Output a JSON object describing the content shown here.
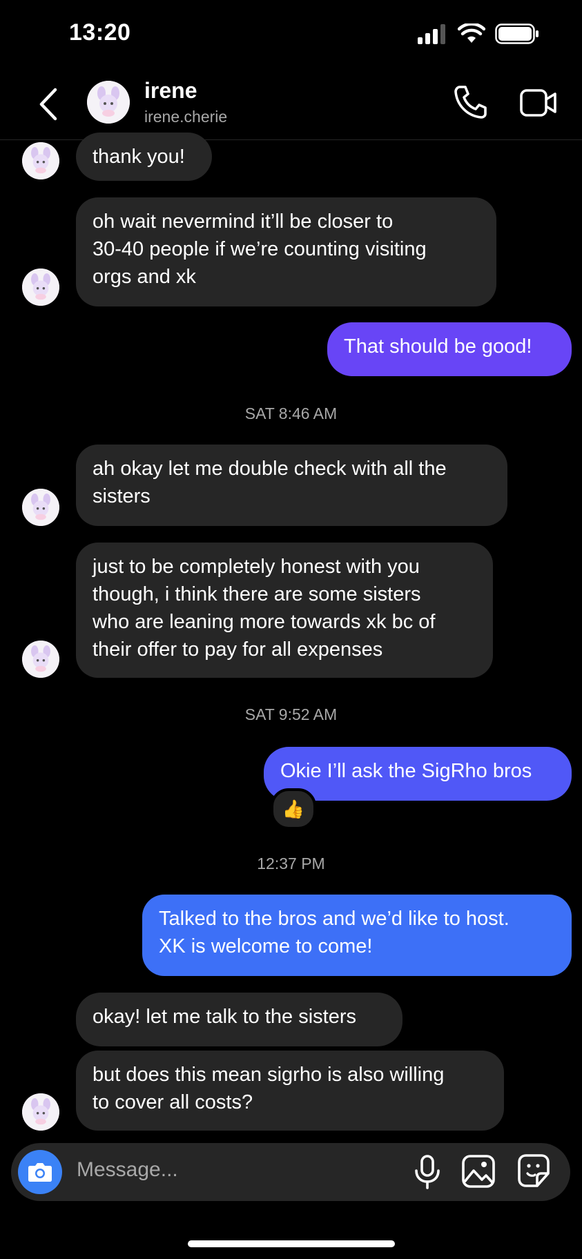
{
  "status_bar": {
    "time": "13:20"
  },
  "header": {
    "name": "irene",
    "username": "irene.cherie"
  },
  "messages": [
    {
      "text": "thank you!"
    },
    {
      "text": "oh wait nevermind it’ll be closer to\n30-40 people if we’re counting visiting\norgs and xk"
    },
    {
      "text": "That should be good!"
    },
    {
      "text": "ah okay let me double check with all the\nsisters"
    },
    {
      "text": "just to be completely honest with you\nthough, i think there are some sisters\nwho are leaning more towards xk bc of\ntheir offer to pay for all expenses"
    },
    {
      "text": "Okie I’ll ask the SigRho bros"
    },
    {
      "text": "Talked to the bros and we’d like to host.\nXK is welcome to come!"
    },
    {
      "text": "okay! let me talk to the sisters"
    },
    {
      "text": "but does this mean sigrho is also willing\nto cover all costs?"
    }
  ],
  "timestamps": [
    "SAT 8:46 AM",
    "SAT 9:52 AM",
    "12:37 PM"
  ],
  "reaction": "👍",
  "composer": {
    "placeholder": "Message..."
  },
  "colors": {
    "incoming": "#262626",
    "outgoing_purple": "#6845f6",
    "outgoing_blue": "#3d70f7"
  }
}
